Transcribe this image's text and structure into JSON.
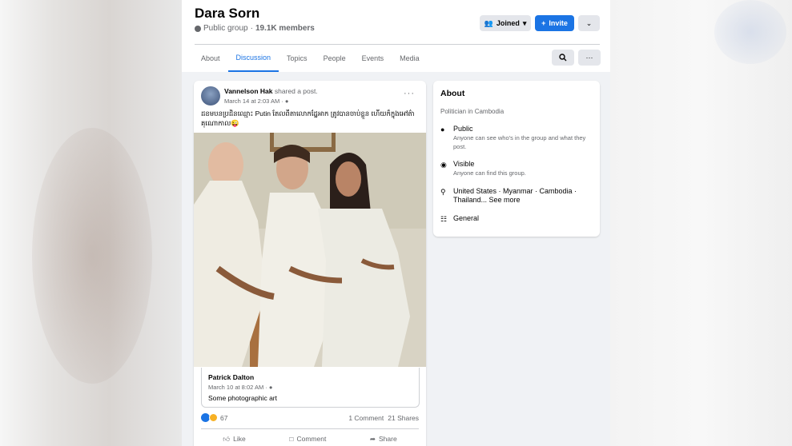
{
  "group": {
    "title": "Dara Sorn",
    "privacy": "Public group",
    "separator": "·",
    "members": "19.1K members",
    "joined_label": "Joined",
    "invite_label": "Invite",
    "tabs": [
      "About",
      "Discussion",
      "Topics",
      "People",
      "Events",
      "Media"
    ],
    "active_tab": "Discussion"
  },
  "post": {
    "author": "Vannelson Hak",
    "action": "shared a post.",
    "time": "March 14 at 2:03 AM ·",
    "text": "ដខមបនប្រដិនឈ្មោះ Putin តែលពីតាលោកដ្ឋែអាក ត្រូវបានចាប់ខ្លួន ហើយក៏ក្នុងអៅត៌ាគុណោកាល😜",
    "shared": {
      "author": "Patrick Dalton",
      "time": "March 10 at 8:02 AM ·",
      "text": "Some photographic art"
    },
    "reaction_count": "67",
    "comments": "1 Comment",
    "shares": "21 Shares",
    "actions": {
      "like": "Like",
      "comment": "Comment",
      "share": "Share"
    }
  },
  "about": {
    "title": "About",
    "description": "Politician in Cambodia",
    "items": [
      {
        "icon": "globe-icon",
        "title": "Public",
        "sub": "Anyone can see who's in the group and what they post."
      },
      {
        "icon": "eye-icon",
        "title": "Visible",
        "sub": "Anyone can find this group."
      },
      {
        "icon": "location-icon",
        "title": "United States · Myanmar · Cambodia · Thailand... See more",
        "sub": ""
      },
      {
        "icon": "people-icon",
        "title": "General",
        "sub": ""
      }
    ]
  },
  "colors": {
    "accent": "#1b74e4",
    "page_bg": "#f0f2f5",
    "secondary_text": "#65676b"
  }
}
